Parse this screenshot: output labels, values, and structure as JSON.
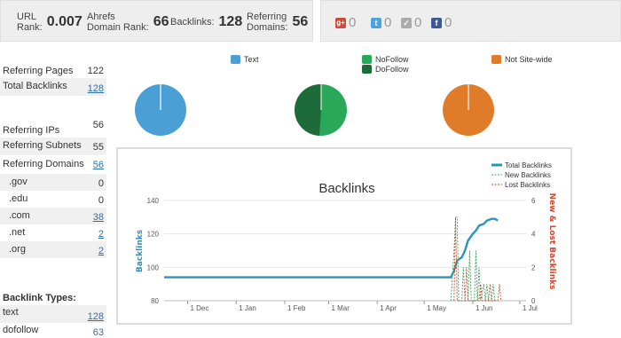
{
  "stats": {
    "url_rank_label_1": "URL",
    "url_rank_label_2": "Rank:",
    "url_rank_value": "0.007",
    "domain_rank_label_1": "Ahrefs",
    "domain_rank_label_2": "Domain Rank:",
    "domain_rank_value": "66",
    "backlinks_label": "Backlinks:",
    "backlinks_value": "128",
    "ref_domains_label_1": "Referring",
    "ref_domains_label_2": "Domains:",
    "ref_domains_value": "56"
  },
  "social": [
    {
      "icon": "google-plus-icon",
      "count": "0",
      "color": "#d14836",
      "glyph": "g+"
    },
    {
      "icon": "twitter-icon",
      "count": "0",
      "color": "#4aa3df",
      "glyph": "t"
    },
    {
      "icon": "like-icon",
      "count": "0",
      "color": "#aaaaaa",
      "glyph": "✓"
    },
    {
      "icon": "facebook-icon",
      "count": "0",
      "color": "#3b5998",
      "glyph": "f"
    }
  ],
  "left_table": {
    "referring_pages_label": "Referring Pages",
    "referring_pages_value": "122",
    "total_backlinks_label": "Total Backlinks",
    "total_backlinks_value": "128",
    "referring_ips_label": "Referring IPs",
    "referring_ips_value": "56",
    "referring_subnets_label": "Referring Subnets",
    "referring_subnets_value": "55",
    "referring_domains_label": "Referring Domains",
    "referring_domains_value": "56",
    "tlds": [
      {
        "label": ".gov",
        "value": "0",
        "link": false
      },
      {
        "label": ".edu",
        "value": "0",
        "link": false
      },
      {
        "label": ".com",
        "value": "38",
        "link": true
      },
      {
        "label": ".net",
        "value": "2",
        "link": true
      },
      {
        "label": ".org",
        "value": "2",
        "link": true
      }
    ],
    "backlink_types_heading": "Backlink Types:",
    "types": [
      {
        "label": "text",
        "value": "128"
      },
      {
        "label": "dofollow",
        "value": "63"
      }
    ]
  },
  "legends": {
    "text": "Text",
    "nofollow": "NoFollow",
    "dofollow": "DoFollow",
    "not_sitewide": "Not Site-wide"
  },
  "colors": {
    "text": "#4a9fd4",
    "nofollow": "#2aa85a",
    "dofollow": "#1e6b3a",
    "not_sitewide": "#e07b2a",
    "total_line": "#2a93c0",
    "new_line": "#3aa060",
    "lost_line": "#c84a30",
    "left_axis": "#2a93c0",
    "right_axis": "#c84a30"
  },
  "chart_data": {
    "type": "line",
    "title": "Backlinks",
    "ylabel": "Backlinks",
    "y2label": "New & Lost Backlinks",
    "ylim": [
      80,
      140
    ],
    "y2lim": [
      0,
      6
    ],
    "yticks": [
      80,
      100,
      120,
      140
    ],
    "y2ticks": [
      0,
      2,
      4,
      6
    ],
    "xlim": [
      "2013-11-16",
      "2014-07-05"
    ],
    "xticks": [
      {
        "date": "2013-12-01",
        "label": "1 Dec"
      },
      {
        "date": "2014-01-01",
        "label": "1 Jan"
      },
      {
        "date": "2014-02-01",
        "label": "1 Feb"
      },
      {
        "date": "2014-03-01",
        "label": "1 Mar"
      },
      {
        "date": "2014-04-01",
        "label": "1 Apr"
      },
      {
        "date": "2014-05-01",
        "label": "1 May"
      },
      {
        "date": "2014-06-01",
        "label": "1 Jun"
      },
      {
        "date": "2014-07-01",
        "label": "1 Jul"
      }
    ],
    "legend_position": "top-right",
    "series": [
      {
        "name": "Total Backlinks",
        "axis": "left",
        "points": [
          [
            "2013-11-16",
            94
          ],
          [
            "2014-05-18",
            94
          ],
          [
            "2014-05-20",
            98
          ],
          [
            "2014-05-22",
            104
          ],
          [
            "2014-05-25",
            106
          ],
          [
            "2014-05-27",
            110
          ],
          [
            "2014-05-29",
            116
          ],
          [
            "2014-06-01",
            120
          ],
          [
            "2014-06-03",
            122
          ],
          [
            "2014-06-05",
            125
          ],
          [
            "2014-06-08",
            126
          ],
          [
            "2014-06-10",
            128
          ],
          [
            "2014-06-13",
            129
          ],
          [
            "2014-06-15",
            129
          ],
          [
            "2014-06-17",
            128
          ]
        ]
      },
      {
        "name": "New Backlinks",
        "axis": "right",
        "points": [
          [
            "2014-05-18",
            0
          ],
          [
            "2014-05-20",
            3
          ],
          [
            "2014-05-21",
            5
          ],
          [
            "2014-05-22",
            5
          ],
          [
            "2014-05-23",
            0
          ],
          [
            "2014-05-25",
            0
          ],
          [
            "2014-05-26",
            2
          ],
          [
            "2014-05-27",
            0
          ],
          [
            "2014-05-29",
            0
          ],
          [
            "2014-05-30",
            3
          ],
          [
            "2014-05-31",
            0
          ],
          [
            "2014-06-02",
            0
          ],
          [
            "2014-06-03",
            3
          ],
          [
            "2014-06-04",
            0
          ],
          [
            "2014-06-05",
            2
          ],
          [
            "2014-06-06",
            0
          ],
          [
            "2014-06-08",
            1
          ],
          [
            "2014-06-09",
            0
          ],
          [
            "2014-06-10",
            1
          ],
          [
            "2014-06-11",
            0
          ],
          [
            "2014-06-13",
            0
          ],
          [
            "2014-06-14",
            1
          ],
          [
            "2014-06-15",
            0
          ]
        ]
      },
      {
        "name": "Lost Backlinks",
        "axis": "right",
        "points": [
          [
            "2014-05-20",
            0
          ],
          [
            "2014-05-21",
            5
          ],
          [
            "2014-05-22",
            0
          ],
          [
            "2014-05-27",
            0
          ],
          [
            "2014-05-28",
            2
          ],
          [
            "2014-05-29",
            0
          ],
          [
            "2014-06-05",
            0
          ],
          [
            "2014-06-06",
            1
          ],
          [
            "2014-06-07",
            0
          ],
          [
            "2014-06-11",
            0
          ],
          [
            "2014-06-12",
            1
          ],
          [
            "2014-06-13",
            0
          ],
          [
            "2014-06-17",
            0
          ],
          [
            "2014-06-18",
            1
          ],
          [
            "2014-06-19",
            0
          ]
        ]
      }
    ]
  }
}
